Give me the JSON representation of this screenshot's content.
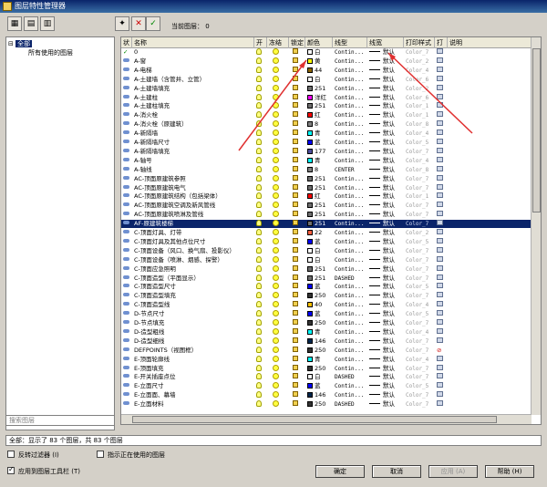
{
  "window": {
    "title": "图层特性管理器"
  },
  "toolbar": {
    "current_layer_label": "当前图层： 0"
  },
  "tree": {
    "all": "全部",
    "used": "所有使用的图层",
    "search_placeholder": "搜索图层"
  },
  "columns": [
    "状",
    "名称",
    "开",
    "冻结",
    "锁定",
    "颜色",
    "线型",
    "线宽",
    "打印样式",
    "打",
    "说明"
  ],
  "rows": [
    {
      "name": "0",
      "color_name": "白",
      "color": "#ffffff",
      "lt": "Contin...",
      "lw": "默认",
      "ps": "Color_7",
      "current": true
    },
    {
      "name": "A-窗",
      "color_name": "黄",
      "color": "#ffff00",
      "lt": "Contin...",
      "lw": "默认",
      "ps": "Color_2"
    },
    {
      "name": "A-电梯",
      "color_name": "44",
      "color": "#8c6400",
      "lt": "Contin...",
      "lw": "默认",
      "ps": "Color_4"
    },
    {
      "name": "A-土建墙（含管井、立管）",
      "color_name": "白",
      "color": "#ffffff",
      "lt": "Contin...",
      "lw": "默认",
      "ps": "Color_6"
    },
    {
      "name": "A-土建墙填充",
      "color_name": "251",
      "color": "#6e6e6e",
      "lt": "Contin...",
      "lw": "默认",
      "ps": "Color_2"
    },
    {
      "name": "A-土建柱",
      "color_name": "洋红",
      "color": "#ff00ff",
      "lt": "Contin...",
      "lw": "默认",
      "ps": "Color_6"
    },
    {
      "name": "A-土建柱填充",
      "color_name": "251",
      "color": "#6e6e6e",
      "lt": "Contin...",
      "lw": "默认",
      "ps": "Color_1"
    },
    {
      "name": "A-消火栓",
      "color_name": "红",
      "color": "#ff0000",
      "lt": "Contin...",
      "lw": "默认",
      "ps": "Color_1"
    },
    {
      "name": "A-消火栓（原建筑）",
      "color_name": "8",
      "color": "#808080",
      "lt": "Contin...",
      "lw": "默认",
      "ps": "Color_8"
    },
    {
      "name": "A-新隔墙",
      "color_name": "青",
      "color": "#00ffff",
      "lt": "Contin...",
      "lw": "默认",
      "ps": "Color_4"
    },
    {
      "name": "A-新隔墙尺寸",
      "color_name": "蓝",
      "color": "#0000ff",
      "lt": "Contin...",
      "lw": "默认",
      "ps": "Color_5"
    },
    {
      "name": "A-新隔墙填充",
      "color_name": "177",
      "color": "#4c4c99",
      "lt": "Contin...",
      "lw": "默认",
      "ps": "Color_7"
    },
    {
      "name": "A-轴号",
      "color_name": "青",
      "color": "#00ffff",
      "lt": "Contin...",
      "lw": "默认",
      "ps": "Color_4"
    },
    {
      "name": "A-轴线",
      "color_name": "8",
      "color": "#808080",
      "lt": "CENTER",
      "lw": "默认",
      "ps": "Color_8"
    },
    {
      "name": "AC-顶面原建筑参照",
      "color_name": "251",
      "color": "#6e6e6e",
      "lt": "Contin...",
      "lw": "默认",
      "ps": "Color_7"
    },
    {
      "name": "AC-顶面原建筑电气",
      "color_name": "251",
      "color": "#6e6e6e",
      "lt": "Contin...",
      "lw": "默认",
      "ps": "Color_7"
    },
    {
      "name": "AC-顶面原建筑结构（包括梁体）",
      "color_name": "红",
      "color": "#ff0000",
      "lt": "Contin...",
      "lw": "默认",
      "ps": "Color_1"
    },
    {
      "name": "AC-顶面原建筑空调及新风管线",
      "color_name": "251",
      "color": "#6e6e6e",
      "lt": "Contin...",
      "lw": "默认",
      "ps": "Color_7"
    },
    {
      "name": "AC-顶面原建筑喷淋及管线",
      "color_name": "251",
      "color": "#6e6e6e",
      "lt": "Contin...",
      "lw": "默认",
      "ps": "Color_7"
    },
    {
      "name": "AF-原建筑楼梯",
      "color_name": "251",
      "color": "#6e6e6e",
      "lt": "Contin...",
      "lw": "默认",
      "ps": "Color_7",
      "active": true
    },
    {
      "name": "C-顶面灯具、灯带",
      "color_name": "22",
      "color": "#ff5f3f",
      "lt": "Contin...",
      "lw": "默认",
      "ps": "Color_2"
    },
    {
      "name": "C-顶面灯具及其他点位尺寸",
      "color_name": "蓝",
      "color": "#0000ff",
      "lt": "Contin...",
      "lw": "默认",
      "ps": "Color_5"
    },
    {
      "name": "C-顶面设备（风口、换气扇、投影仪）",
      "color_name": "白",
      "color": "#ffffff",
      "lt": "Contin...",
      "lw": "默认",
      "ps": "Color_7"
    },
    {
      "name": "C-顶面设备（喷淋、烟感、探警）",
      "color_name": "白",
      "color": "#ffffff",
      "lt": "Contin...",
      "lw": "默认",
      "ps": "Color_7"
    },
    {
      "name": "C-顶面应急照明",
      "color_name": "251",
      "color": "#6e6e6e",
      "lt": "Contin...",
      "lw": "默认",
      "ps": "Color_7"
    },
    {
      "name": "C-顶面造型（平面显示）",
      "color_name": "251",
      "color": "#6e6e6e",
      "lt": "DASHED",
      "lw": "默认",
      "ps": "Color_7"
    },
    {
      "name": "C-顶面造型尺寸",
      "color_name": "蓝",
      "color": "#0000ff",
      "lt": "Contin...",
      "lw": "默认",
      "ps": "Color_5"
    },
    {
      "name": "C-顶面造型填充",
      "color_name": "250",
      "color": "#333333",
      "lt": "Contin...",
      "lw": "默认",
      "ps": "Color_7"
    },
    {
      "name": "C-顶面造型线",
      "color_name": "40",
      "color": "#ffbf00",
      "lt": "Contin...",
      "lw": "默认",
      "ps": "Color_4"
    },
    {
      "name": "D-节点尺寸",
      "color_name": "蓝",
      "color": "#0000ff",
      "lt": "Contin...",
      "lw": "默认",
      "ps": "Color_5"
    },
    {
      "name": "D-节点填充",
      "color_name": "250",
      "color": "#333333",
      "lt": "Contin...",
      "lw": "默认",
      "ps": "Color_7"
    },
    {
      "name": "D-造型粗线",
      "color_name": "青",
      "color": "#00ffff",
      "lt": "Contin...",
      "lw": "默认",
      "ps": "Color_4"
    },
    {
      "name": "D-造型细线",
      "color_name": "146",
      "color": "#00264c",
      "lt": "Contin...",
      "lw": "默认",
      "ps": "Color_7"
    },
    {
      "name": "DEFPOINTS（视图框）",
      "color_name": "250",
      "color": "#333333",
      "lt": "Contin...",
      "lw": "默认",
      "ps": "Color_7",
      "noprint": true
    },
    {
      "name": "E-顶面轮廓线",
      "color_name": "青",
      "color": "#00ffff",
      "lt": "Contin...",
      "lw": "默认",
      "ps": "Color_4"
    },
    {
      "name": "E-顶面填充",
      "color_name": "250",
      "color": "#333333",
      "lt": "Contin...",
      "lw": "默认",
      "ps": "Color_7"
    },
    {
      "name": "E-开关插座点位",
      "color_name": "白",
      "color": "#ffffff",
      "lt": "DASHED",
      "lw": "默认",
      "ps": "Color_7"
    },
    {
      "name": "E-立面尺寸",
      "color_name": "蓝",
      "color": "#0000ff",
      "lt": "Contin...",
      "lw": "默认",
      "ps": "Color_5"
    },
    {
      "name": "E-立面面、幕墙",
      "color_name": "146",
      "color": "#00264c",
      "lt": "Contin...",
      "lw": "默认",
      "ps": "Color_7"
    },
    {
      "name": "E-立面材料",
      "color_name": "250",
      "color": "#333333",
      "lt": "DASHED",
      "lw": "默认",
      "ps": "Color_7"
    }
  ],
  "status": "全部：显示了 83 个图层，共 83 个图层",
  "options": {
    "invert_filter": "反转过滤器 (I)",
    "show_used": "指示正在使用的图层",
    "apply_toolbar": "应用到图层工具栏 (T)"
  },
  "buttons": {
    "ok": "确定",
    "cancel": "取消",
    "apply": "应用 (A)",
    "help": "帮助 (H)"
  }
}
